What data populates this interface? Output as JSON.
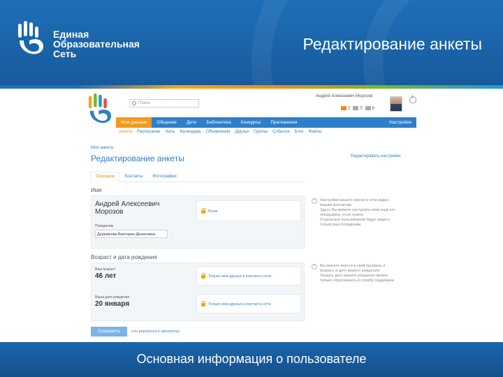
{
  "slide": {
    "logo_line1": "Единая",
    "logo_line2": "Образовательная",
    "logo_line3": "Сеть",
    "title": "Редактирование анкеты",
    "footer_caption": "Основная информация о пользователе"
  },
  "colors": {
    "brand_blue": "#1e6fb8",
    "nav_blue": "#2e7fc9",
    "accent_orange": "#f29a1f"
  },
  "app": {
    "search_placeholder": "Поиск",
    "user_name": "Андрей Алексеевич Морозов",
    "counters": [
      "2",
      "0",
      "8"
    ],
    "nav": [
      "Мои данные",
      "Общение",
      "Дети",
      "Библиотека",
      "Конкурсы",
      "Приложения"
    ],
    "nav_settings": "Настройки",
    "subnav": [
      "Анкета",
      "Расписание",
      "Чаты",
      "Календарь",
      "Объявления",
      "Друзья",
      "Группы",
      "События",
      "Блог",
      "Файлы"
    ],
    "breadcrumb": "Моя анкета",
    "page_title": "Редактирование анкеты",
    "edit_settings": "Редактировать настройки",
    "tabs": [
      "Основное",
      "Контакты",
      "Фотографии"
    ],
    "name_section": {
      "label": "Имя",
      "fullname_line1": "Андрей Алексеевич",
      "fullname_line2": "Морозов",
      "privacy": "Всем",
      "pseudonym_label": "Псевдоним",
      "pseudonym_value": "Душникова Виктория Денисовна"
    },
    "age_section": {
      "label": "Возраст и дата рождения",
      "age_label": "Ваш возраст",
      "age_value": "46 лет",
      "age_privacy": "Только мои друзья и контакты сети",
      "birth_label": "Ваша дата рождения",
      "birth_value": "20 января",
      "birth_privacy": "Только мои друзья и контакты сети"
    },
    "help_name": [
      "Настройки вашего имени в сети видно",
      "вашим контактам.",
      "Здесь Вы можете настроить кому ещё его",
      "показывать, если нужно.",
      "Отдельные пользователи будут видеть",
      "только ваш псевдоним."
    ],
    "help_age": [
      "Вы можете внести в свой профиль и",
      "возраст, и дату вашего рождения.",
      "Указать дату вашего рождения можно",
      "только обратившись в службу поддержки."
    ],
    "save_label": "Сохранить",
    "cancel_prefix": "или",
    "cancel_label": "вернуться к просмотру"
  }
}
